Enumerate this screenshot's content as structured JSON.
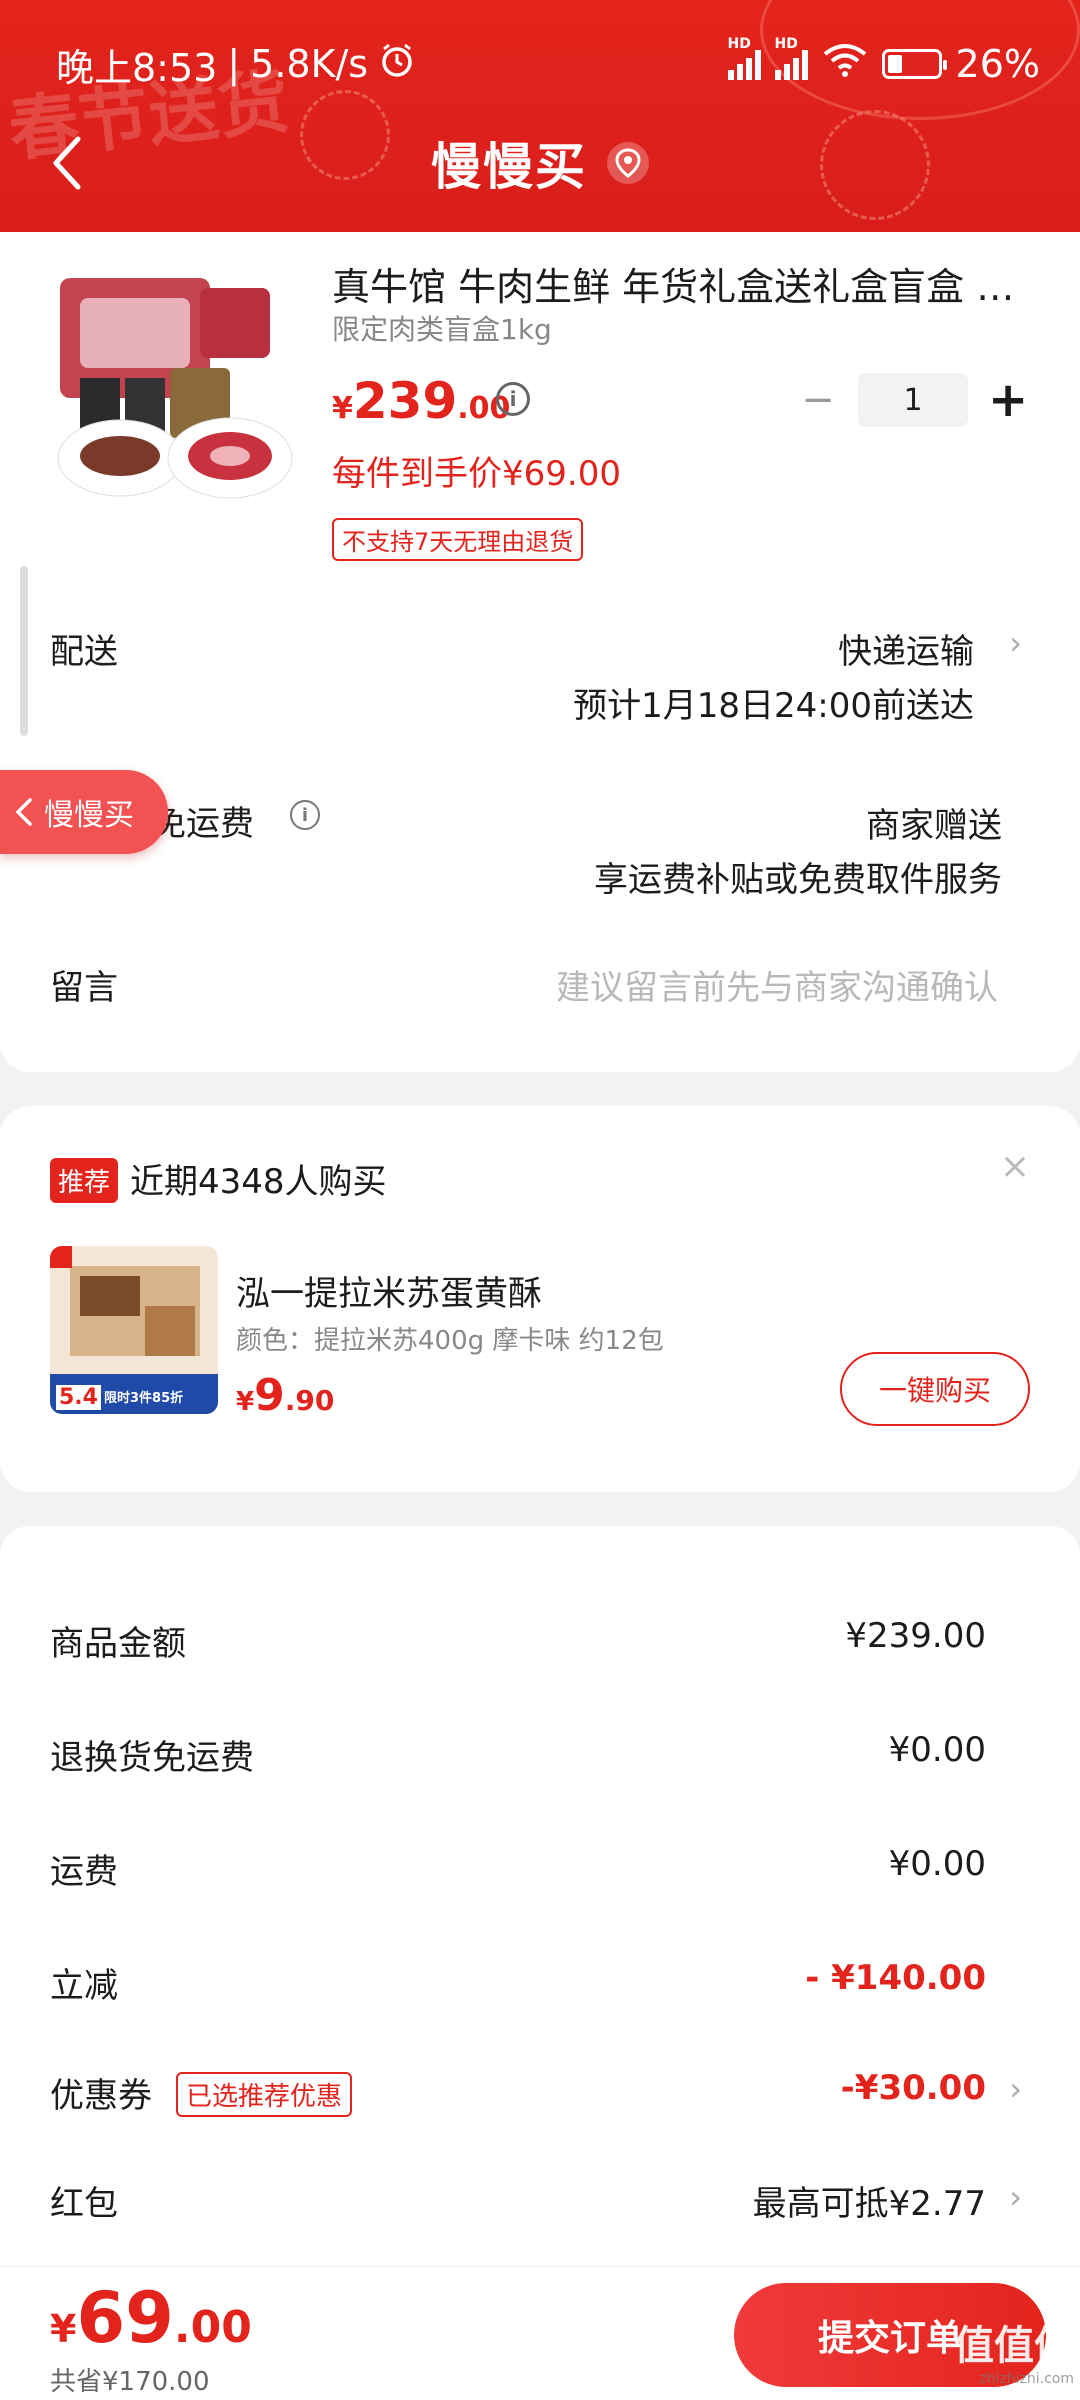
{
  "status_bar": {
    "time": "晚上8:53",
    "speed": "5.8K/s",
    "battery": "26%"
  },
  "header": {
    "decor_text": "春节送货",
    "title": "慢慢买"
  },
  "product": {
    "title": "真牛馆 牛肉生鲜 年货礼盒送礼盒盲盒 限定肉类盲盒1kg",
    "sku": "限定肉类盲盒1kg",
    "price_currency": "¥",
    "price_int": "239",
    "price_dec": ".00",
    "quantity": "1",
    "each_price": "每件到手价¥69.00",
    "return_tag": "不支持7天无理由退货"
  },
  "delivery": {
    "label": "配送",
    "method": "快递运输",
    "eta": "预计1月18日24:00前送达"
  },
  "float_pill": {
    "label": "慢慢买"
  },
  "return_fee": {
    "label": "退换货免运费",
    "value": "商家赠送",
    "desc": "享运费补贴或免费取件服务"
  },
  "message": {
    "label": "留言",
    "placeholder": "建议留言前先与商家沟通确认"
  },
  "recommend": {
    "badge": "推荐",
    "title": "近期4348人购买",
    "item_name": "泓一提拉米苏蛋黄酥",
    "item_sku": "颜色：提拉米苏400g 摩卡味  约12包",
    "price_currency": "¥",
    "price_int": "9",
    "price_dec": ".90",
    "buy_label": "一键购买",
    "img_badge": "5.4",
    "img_promo": "限时3件85折"
  },
  "summary": {
    "goods_label": "商品金额",
    "goods_value": "¥239.00",
    "return_label": "退换货免运费",
    "return_value": "¥0.00",
    "shipping_label": "运费",
    "shipping_value": "¥0.00",
    "discount_label": "立减",
    "discount_value": "- ¥140.00",
    "coupon_label": "优惠券",
    "coupon_tag": "已选推荐优惠",
    "coupon_value": "-¥30.00",
    "redpack_label": "红包",
    "redpack_value": "最高可抵¥2.77"
  },
  "bottom": {
    "total_currency": "¥",
    "total_int": "69",
    "total_dec": ".00",
    "saved": "共省¥170.00",
    "submit": "提交订单",
    "watermark": "值值值",
    "watermark_url": "zhizhizhi.com"
  },
  "colors": {
    "brand_red": "#e3241d",
    "background": "#f2f2f2"
  }
}
